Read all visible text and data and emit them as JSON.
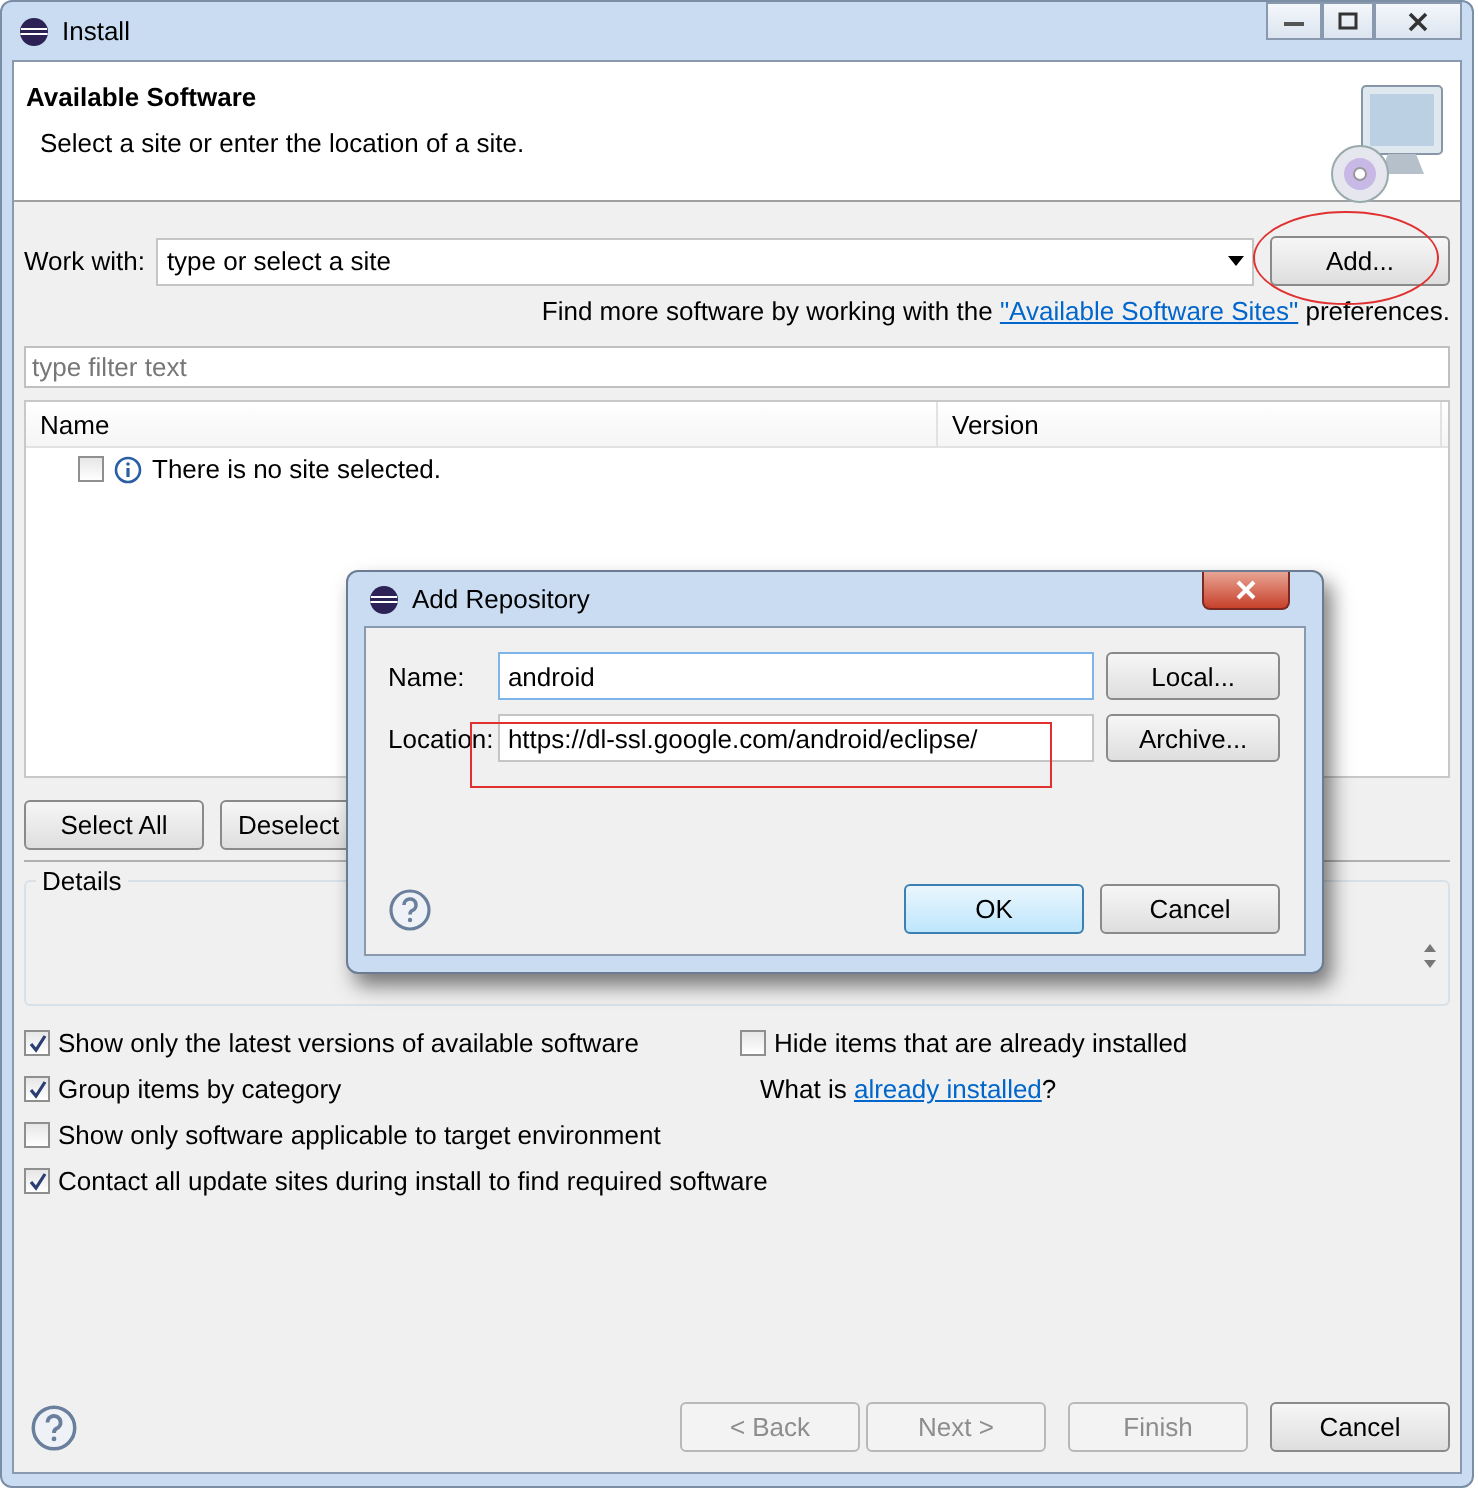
{
  "window": {
    "title": "Install"
  },
  "header": {
    "title": "Available Software",
    "subtitle": "Select a site or enter the location of a site."
  },
  "work_with": {
    "label": "Work with:",
    "placeholder": "type or select a site",
    "button": "Add..."
  },
  "more_software": {
    "prefix": "Find more software by working with the ",
    "link": "\"Available Software Sites\"",
    "suffix": " preferences."
  },
  "filter": {
    "placeholder": "type filter text"
  },
  "table": {
    "columns": [
      "Name",
      "Version"
    ],
    "rows": [
      {
        "text": "There is no site selected.",
        "checked": false
      }
    ]
  },
  "list_buttons": [
    "Select All",
    "Deselect"
  ],
  "details": {
    "title": "Details"
  },
  "options_left": [
    {
      "label": "Show only the latest versions of available software",
      "checked": true
    },
    {
      "label": "Group items by category",
      "checked": true
    },
    {
      "label": "Show only software applicable to target environment",
      "checked": false
    },
    {
      "label": "Contact all update sites during install to find required software",
      "checked": true
    }
  ],
  "options_right": {
    "hide": {
      "label": "Hide items that are already installed",
      "checked": false
    },
    "what_is": {
      "prefix": "What is ",
      "link": "already installed",
      "suffix": "?"
    }
  },
  "footer_buttons": [
    {
      "label": "< Back",
      "disabled": true
    },
    {
      "label": "Next >",
      "disabled": true
    },
    {
      "label": "Finish",
      "disabled": true
    },
    {
      "label": "Cancel",
      "disabled": false
    }
  ],
  "dialog": {
    "title": "Add Repository",
    "fields": [
      {
        "label": "Name:",
        "value": "android",
        "button": "Local..."
      },
      {
        "label": "Location:",
        "value": "https://dl-ssl.google.com/android/eclipse/",
        "button": "Archive..."
      }
    ],
    "buttons": [
      {
        "label": "OK",
        "selected": true
      },
      {
        "label": "Cancel",
        "selected": false
      }
    ]
  }
}
